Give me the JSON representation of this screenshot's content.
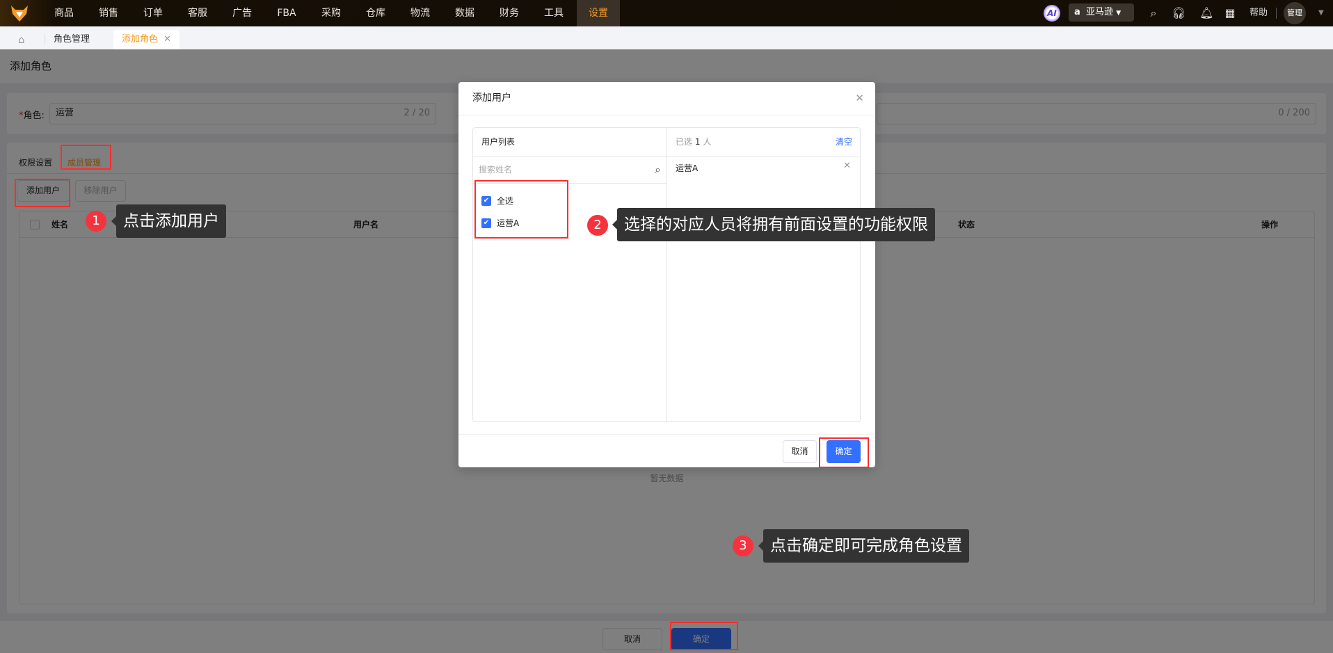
{
  "nav": {
    "items": [
      "商品",
      "销售",
      "订单",
      "客服",
      "广告",
      "FBA",
      "采购",
      "仓库",
      "物流",
      "数据",
      "财务",
      "工具",
      "设置"
    ],
    "active": "设置",
    "ai": "AI",
    "store": "亚马逊",
    "help": "帮助",
    "user": "管理"
  },
  "tabs": {
    "role_mgmt": "角色管理",
    "add_role": "添加角色"
  },
  "page": {
    "title": "添加角色",
    "role_label": "角色:",
    "role_required": "*",
    "role_value": "运营",
    "role_count": "2 / 20",
    "desc_count": "0 / 200",
    "subtabs": [
      "权限设置",
      "成员管理"
    ],
    "add_user": "添加用户",
    "remove_user": "移除用户",
    "columns": [
      "姓名",
      "用户名",
      "状态",
      "操作"
    ],
    "empty": "暂无数据",
    "cancel": "取消",
    "confirm": "确定"
  },
  "modal": {
    "title": "添加用户",
    "list_title": "用户列表",
    "selected_prefix": "已选",
    "selected_count": "1",
    "selected_suffix": "人",
    "clear": "清空",
    "search_placeholder": "搜索姓名",
    "options": [
      "全选",
      "运营A"
    ],
    "selected_items": [
      "运营A"
    ],
    "cancel": "取消",
    "confirm": "确定"
  },
  "annotations": [
    {
      "num": "1",
      "text": "点击添加用户"
    },
    {
      "num": "2",
      "text": "选择的对应人员将拥有前面设置的功能权限"
    },
    {
      "num": "3",
      "text": "点击确定即可完成角色设置"
    }
  ],
  "colors": {
    "accent": "#f59a23",
    "primary": "#3370ff",
    "annotation_red": "#ff2d2d"
  }
}
